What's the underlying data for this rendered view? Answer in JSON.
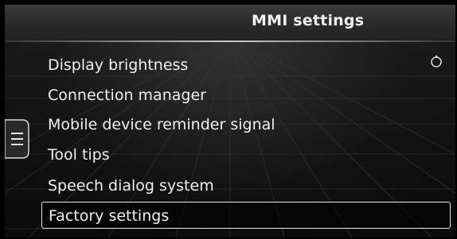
{
  "header": {
    "title": "MMI settings"
  },
  "menu": {
    "items": [
      {
        "label": "Display brightness"
      },
      {
        "label": "Connection manager"
      },
      {
        "label": "Mobile device reminder signal"
      },
      {
        "label": "Tool tips"
      },
      {
        "label": "Speech dialog system"
      },
      {
        "label": "Factory settings",
        "selected": true
      }
    ]
  },
  "icons": {
    "side_tab": "menu-tab-icon",
    "rotary": "rotary-knob-icon"
  },
  "colors": {
    "text": "#efefef",
    "header_bg": "#2a2a2a",
    "selection_border": "#e8e8e8",
    "background": "#111111"
  }
}
